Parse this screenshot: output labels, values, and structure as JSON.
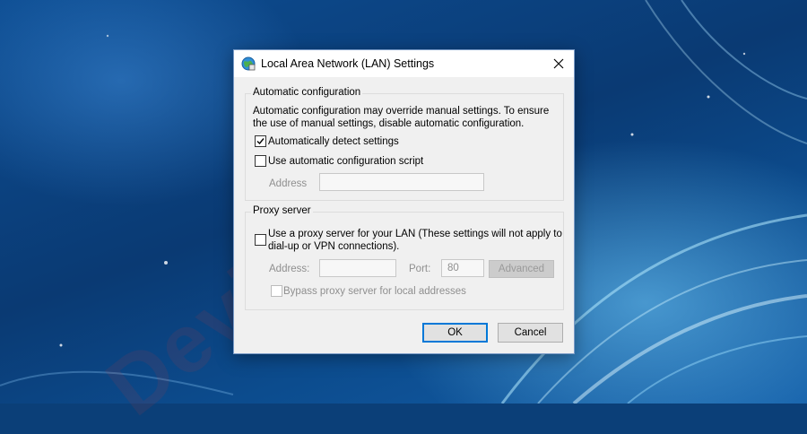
{
  "dialog": {
    "title": "Local Area Network (LAN) Settings"
  },
  "watermark": "DeviceTricks",
  "auto_config": {
    "group_label": "Automatic configuration",
    "description": "Automatic configuration may override manual settings.  To ensure the use of manual settings, disable automatic configuration.",
    "detect_settings": {
      "label": "Automatically detect settings",
      "checked": true
    },
    "use_script": {
      "label": "Use automatic configuration script",
      "checked": false
    },
    "address_label": "Address",
    "address_value": ""
  },
  "proxy": {
    "group_label": "Proxy server",
    "use_proxy_line1": "Use a proxy server for your LAN (These settings will not apply to",
    "use_proxy_line2": "dial-up or VPN connections).",
    "use_proxy_checked": false,
    "address_label": "Address:",
    "address_value": "",
    "port_label": "Port:",
    "port_value": "80",
    "advanced_label": "Advanced",
    "bypass": {
      "label": "Bypass proxy server for local addresses",
      "checked": false
    }
  },
  "buttons": {
    "ok": "OK",
    "cancel": "Cancel"
  },
  "colors": {
    "accent": "#0078d7",
    "desktop": "#0b3f78"
  },
  "icons": {
    "title": "network-globe-icon",
    "close": "close-icon",
    "check": "checkmark-icon"
  }
}
